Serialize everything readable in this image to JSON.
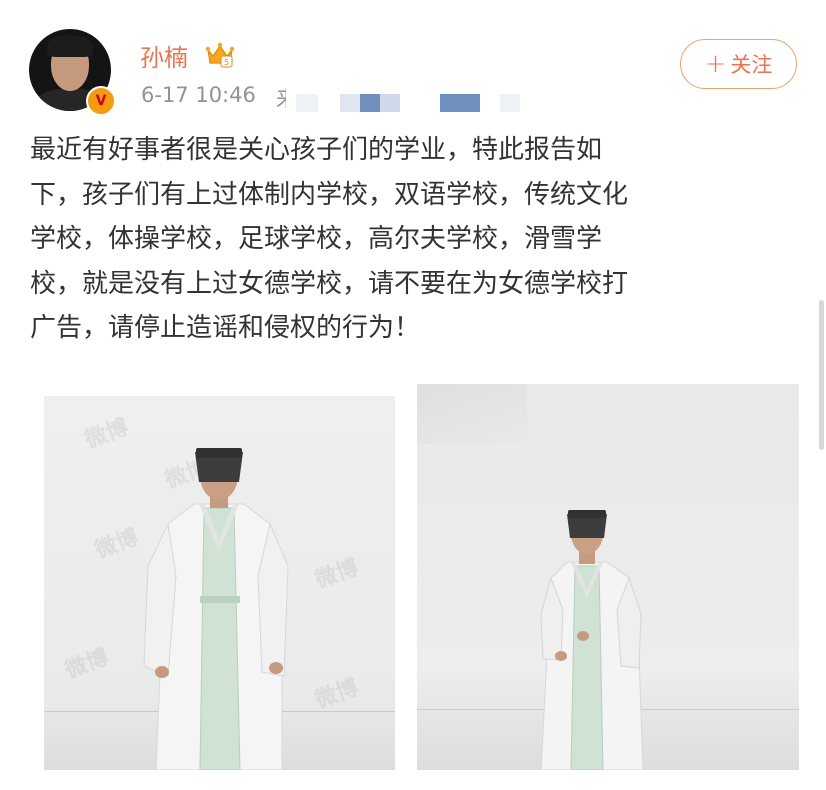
{
  "user": {
    "name": "孙楠",
    "timestamp": "6-17 10:46",
    "meta_extra": "来",
    "verified_badge": "V"
  },
  "follow_button": {
    "label": "关注",
    "icon": "plus-icon"
  },
  "post": {
    "lines": [
      "最近有好事者很是关心孩子们的学业，特此报告如",
      "下，孩子们有上过体制内学校，双语学校，传统文化",
      "学校，体操学校，足球学校，高尔夫学校，滑雪学",
      "校，就是没有上过女德学校，请不要在为女德学校打",
      "广告，请停止造谣和侵权的行为！"
    ]
  },
  "photos": {
    "watermark": "微博"
  },
  "colors": {
    "accent": "#eb7350",
    "text": "#333333",
    "meta": "#939393",
    "badge": "#f39c12"
  }
}
